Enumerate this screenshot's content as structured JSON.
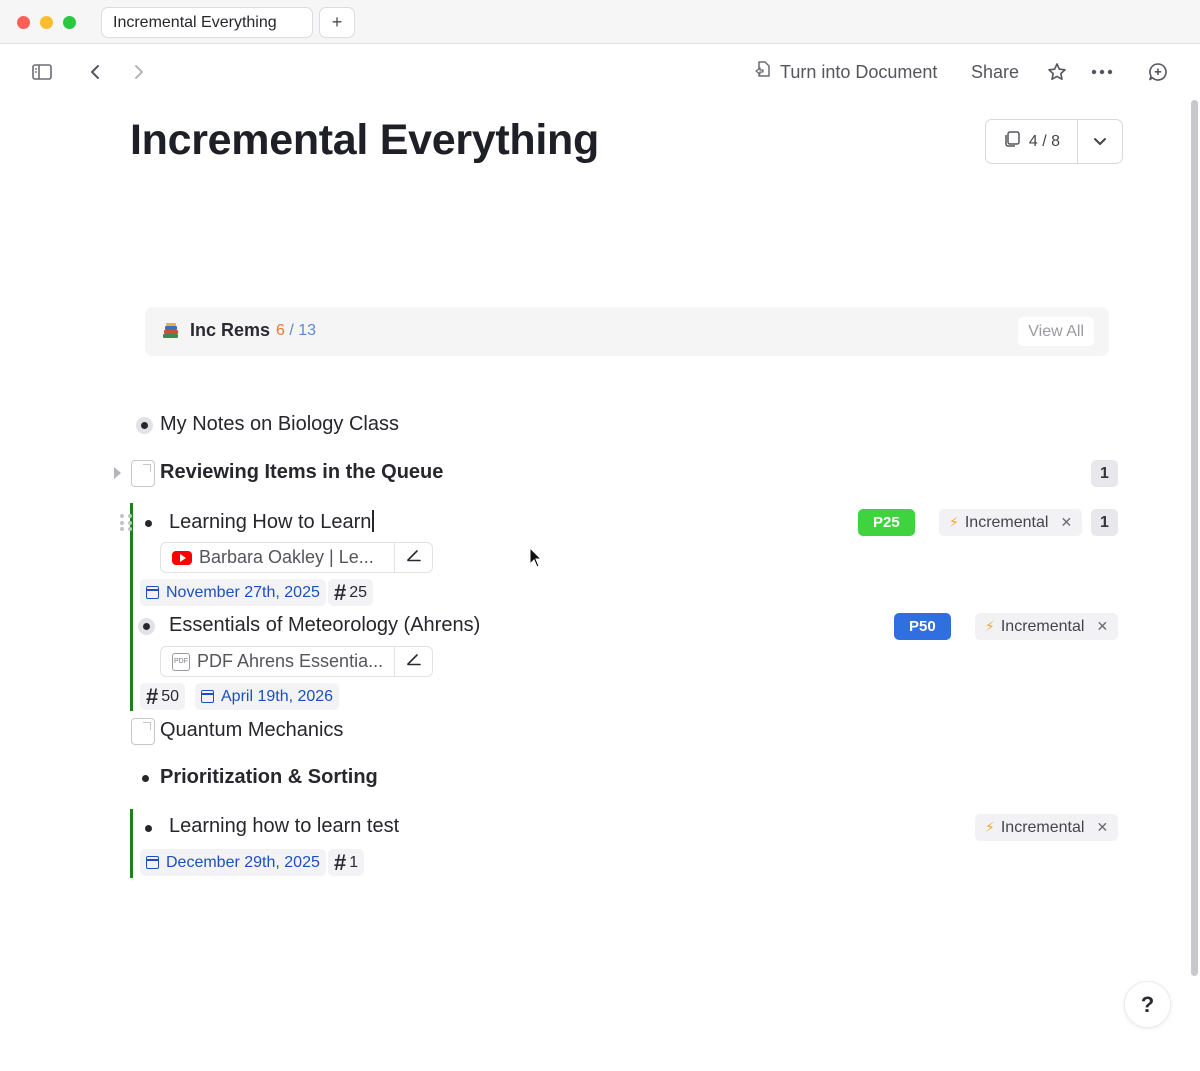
{
  "window": {
    "tab_title": "Incremental Everything",
    "new_tab_label": "+"
  },
  "toolbar": {
    "turn_into_document": "Turn into Document",
    "share": "Share"
  },
  "page": {
    "title": "Incremental Everything",
    "counter": "4 / 8"
  },
  "inc_rems": {
    "title": "Inc Rems",
    "current": "6",
    "separator": " / ",
    "total": "13",
    "view_all": "View All"
  },
  "items": {
    "biology": {
      "text": "My Notes on Biology Class"
    },
    "reviewing": {
      "text": "Reviewing Items in the Queue",
      "count": "1"
    },
    "learning": {
      "text": "Learning How to Learn",
      "priority": "P25",
      "priority_color": "#3fd33f",
      "tag": "Incremental",
      "count": "1",
      "source": "Barbara Oakley | Le...",
      "date": "November 27th, 2025",
      "number": "25"
    },
    "meteorology": {
      "text": "Essentials of Meteorology (Ahrens)",
      "priority": "P50",
      "priority_color": "#2f6fe0",
      "tag": "Incremental",
      "source": "PDF Ahrens Essentia...",
      "number": "50",
      "date": "April 19th, 2026"
    },
    "quantum": {
      "text": "Quantum Mechanics"
    },
    "prioritization": {
      "text": "Prioritization & Sorting"
    },
    "learning_test": {
      "text": "Learning how to learn test",
      "tag": "Incremental",
      "date": "December 29th, 2025",
      "number": "1"
    }
  },
  "help": {
    "label": "?"
  },
  "colors": {
    "accent_green_bar": "#1d7f1d",
    "date_blue": "#1c4fbf",
    "bolt_orange": "#f0a830"
  }
}
